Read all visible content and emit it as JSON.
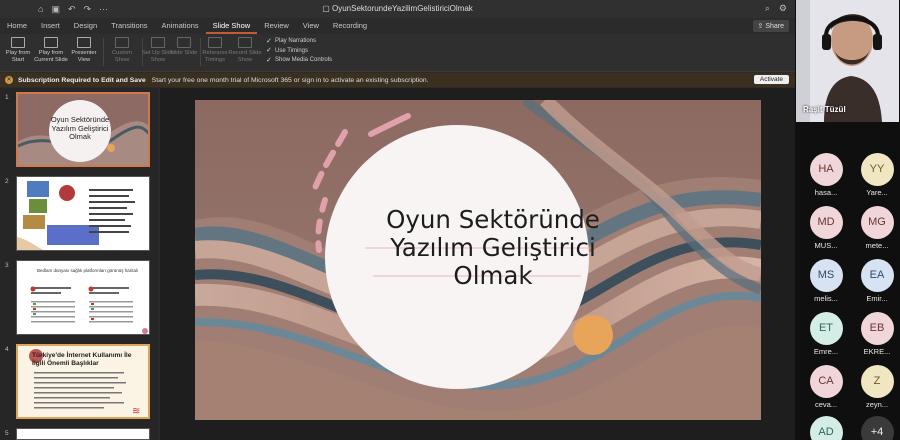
{
  "window": {
    "doc_title": "OyunSektorundeYazilimGelistiriciOlmak"
  },
  "tabs": [
    {
      "label": "Home"
    },
    {
      "label": "Insert"
    },
    {
      "label": "Design"
    },
    {
      "label": "Transitions"
    },
    {
      "label": "Animations"
    },
    {
      "label": "Slide Show",
      "active": true
    },
    {
      "label": "Review"
    },
    {
      "label": "View"
    },
    {
      "label": "Recording"
    }
  ],
  "share_label": "Share",
  "ribbon": {
    "play_from_start": "Play from Start",
    "play_from_current": "Play from Current Slide",
    "presenter_view": "Presenter View",
    "custom_show": "Custom Show",
    "set_up_show": "Set Up Slide Show",
    "hide_slide": "Hide Slide",
    "rehearse": "Rehearse Timings",
    "record": "Record Slide Show",
    "play_narrations": "Play Narrations",
    "use_timings": "Use Timings",
    "show_media_controls": "Show Media Controls"
  },
  "notification": {
    "title": "Subscription Required to Edit and Save",
    "message": "Start your free one month trial of Microsoft 365 or sign in to activate an existing subscription.",
    "button": "Activate"
  },
  "thumbnails": [
    {
      "num": "1",
      "title": "Oyun Sektöründe Yazılım Geliştirici Olmak"
    },
    {
      "num": "2"
    },
    {
      "num": "3",
      "title": "Bedlam dünyası sağlık platformları görünüş haritalı"
    },
    {
      "num": "4",
      "title": "Türkiye'de İnternet Kullanımı İle İlgili Önemli Başlıklar"
    },
    {
      "num": "5"
    }
  ],
  "slide": {
    "title_lines": [
      "Oyun Sektöründe",
      "Yazılım Geliştirici",
      "Olmak"
    ]
  },
  "participants": {
    "speaker": "Raşit Tüzül",
    "list": [
      {
        "initials": "HA",
        "name": "hasa..."
      },
      {
        "initials": "YY",
        "name": "Yare..."
      },
      {
        "initials": "MD",
        "name": "MUS..."
      },
      {
        "initials": "MG",
        "name": "mete..."
      },
      {
        "initials": "MS",
        "name": "melis..."
      },
      {
        "initials": "EA",
        "name": "Emir..."
      },
      {
        "initials": "ET",
        "name": "Emre..."
      },
      {
        "initials": "EB",
        "name": "EKRE..."
      },
      {
        "initials": "CA",
        "name": "ceva..."
      },
      {
        "initials": "Z",
        "name": "zeyn..."
      },
      {
        "initials": "AD",
        "name": ""
      },
      {
        "initials": "+4",
        "name": ""
      }
    ]
  }
}
